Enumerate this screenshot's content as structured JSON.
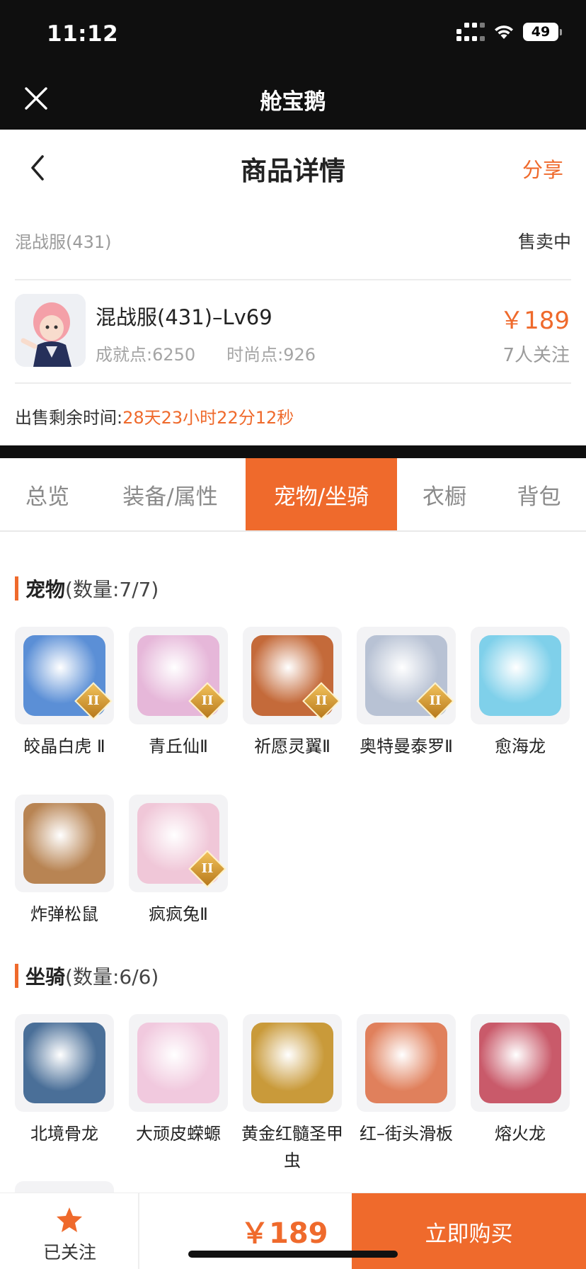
{
  "status_bar": {
    "time": "11:12",
    "battery": "49"
  },
  "app_bar": {
    "title": "舱宝鹅"
  },
  "header": {
    "title": "商品详情",
    "share_label": "分享"
  },
  "listing": {
    "server": "混战服(431)",
    "status": "售卖中",
    "name": "混战服(431)–Lv69",
    "achievement": "成就点:6250",
    "fashion": "时尚点:926",
    "price": "￥189",
    "watchers": "7人关注",
    "timer_label": "出售剩余时间:",
    "timer_value": "28天23小时22分12秒"
  },
  "tabs": [
    {
      "label": "总览",
      "active": false
    },
    {
      "label": "装备/属性",
      "active": false
    },
    {
      "label": "宠物/坐骑",
      "active": true
    },
    {
      "label": "衣橱",
      "active": false
    },
    {
      "label": "背包",
      "active": false
    }
  ],
  "pets": {
    "title": "宠物",
    "count": "(数量:7/7)",
    "items": [
      {
        "name": "皎晶白虎 Ⅱ",
        "badge": "II",
        "color": "#5b8fd6"
      },
      {
        "name": "青丘仙Ⅱ",
        "badge": "II",
        "color": "#e6b7d9"
      },
      {
        "name": "祈愿灵翼Ⅱ",
        "badge": "II",
        "color": "#c46a3a"
      },
      {
        "name": "奥特曼泰罗Ⅱ",
        "badge": "II",
        "color": "#b8c2d4"
      },
      {
        "name": "愈海龙",
        "badge": "",
        "color": "#7fd0ea"
      },
      {
        "name": "炸弹松鼠",
        "badge": "",
        "color": "#b88453"
      },
      {
        "name": "疯疯兔Ⅱ",
        "badge": "II",
        "color": "#f0c7d8"
      }
    ]
  },
  "mounts": {
    "title": "坐骑",
    "count": "(数量:6/6)",
    "items": [
      {
        "name": "北境骨龙",
        "color": "#4a6f98"
      },
      {
        "name": "大顽皮蝾螈",
        "color": "#f1c9de"
      },
      {
        "name": "黄金红髓圣甲虫",
        "color": "#c99a3a"
      },
      {
        "name": "红–街头滑板",
        "color": "#e0805c"
      },
      {
        "name": "熔火龙",
        "color": "#c95a6a"
      }
    ]
  },
  "bottom_bar": {
    "follow_label": "已关注",
    "price": "￥189",
    "buy_label": "立即购买"
  },
  "accent_color": "#ef6a2c"
}
